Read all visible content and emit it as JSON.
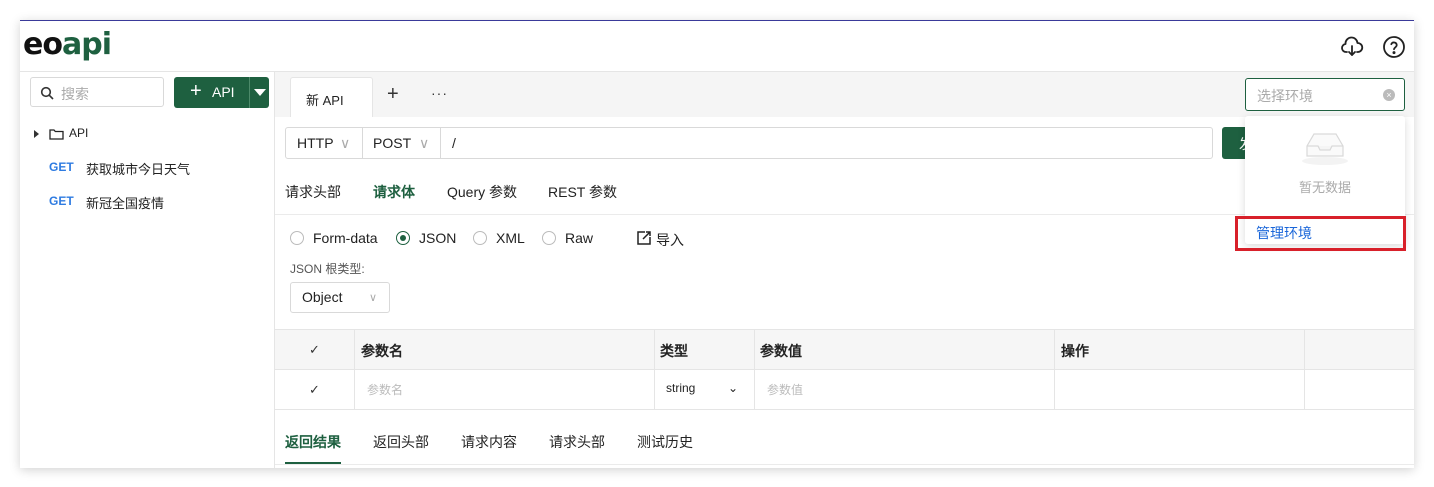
{
  "logo": {
    "eo": "eo",
    "api": "api"
  },
  "header": {
    "icons": [
      "cloud-download-icon",
      "help-circle-icon"
    ]
  },
  "sidebar": {
    "search_placeholder": "搜索",
    "add_button_label": "API",
    "tree": {
      "folder_label": "API"
    },
    "apis": [
      {
        "method": "GET",
        "name": "获取城市今日天气"
      },
      {
        "method": "GET",
        "name": "新冠全国疫情"
      }
    ]
  },
  "tabs": {
    "items": [
      {
        "label": "新 API"
      }
    ],
    "add": "+",
    "more": "···"
  },
  "env": {
    "placeholder": "选择环境",
    "empty_text": "暂无数据",
    "manage_label": "管理环境"
  },
  "request": {
    "protocol": "HTTP",
    "method": "POST",
    "url": "/",
    "send_label": "发"
  },
  "subtabs": [
    "请求头部",
    "请求体",
    "Query 参数",
    "REST 参数"
  ],
  "active_subtab": "请求体",
  "body_types": [
    {
      "label": "Form-data",
      "selected": false
    },
    {
      "label": "JSON",
      "selected": true
    },
    {
      "label": "XML",
      "selected": false
    },
    {
      "label": "Raw",
      "selected": false
    }
  ],
  "import_label": "导入",
  "json_root_label": "JSON 根类型:",
  "json_root_value": "Object",
  "table": {
    "headers": [
      "参数名",
      "类型",
      "参数值",
      "操作"
    ],
    "row": {
      "name_placeholder": "参数名",
      "type": "string",
      "value_placeholder": "参数值"
    }
  },
  "response_tabs": [
    "返回结果",
    "返回头部",
    "请求内容",
    "请求头部",
    "测试历史"
  ],
  "active_response_tab": "返回结果",
  "colors": {
    "brand": "#1e6040",
    "link": "#1a66d9",
    "method_get": "#2e7be1",
    "highlight": "#d8202a"
  }
}
